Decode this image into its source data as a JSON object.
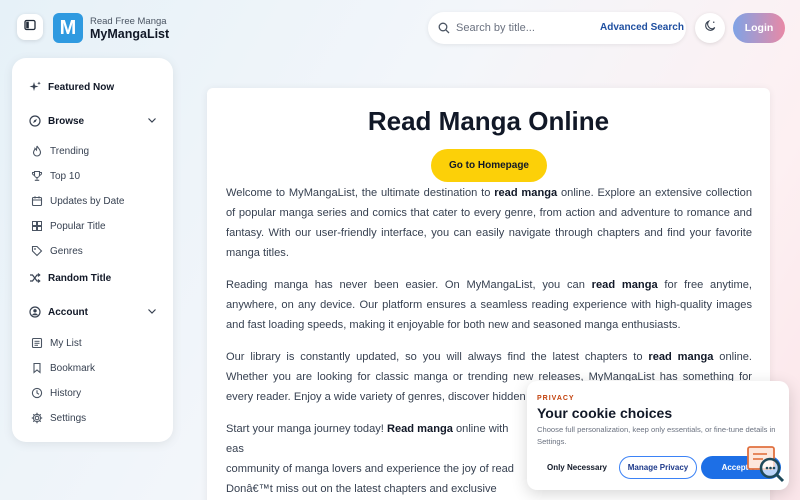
{
  "header": {
    "brand_sub": "Read Free Manga",
    "brand_name": "MyMangaList",
    "logo_letter": "M",
    "search_placeholder": "Search by title...",
    "advanced_search": "Advanced Search",
    "login": "Login"
  },
  "sidebar": {
    "featured": "Featured Now",
    "browse": "Browse",
    "browse_items": [
      "Trending",
      "Top 10",
      "Updates by Date",
      "Popular Title",
      "Genres"
    ],
    "random": "Random Title",
    "account": "Account",
    "account_items": [
      "My List",
      "Bookmark",
      "History",
      "Settings"
    ]
  },
  "main": {
    "title": "Read Manga Online",
    "home_button": "Go to Homepage",
    "p1": [
      "Welcome to MyMangaList, the ultimate destination to ",
      "read manga",
      " online. Explore an extensive collection of popular manga series and comics that cater to every genre, from action and adventure to romance and fantasy. With our user-friendly interface, you can easily navigate through chapters and find your favorite manga titles."
    ],
    "p2": [
      "Reading manga has never been easier. On MyMangaList, you can ",
      "read manga",
      " for free anytime, anywhere, on any device. Our platform ensures a seamless reading experience with high-quality images and fast loading speeds, making it enjoyable for both new and seasoned manga enthusiasts."
    ],
    "p3": [
      "Our library is constantly updated, so you will always find the latest chapters to ",
      "read manga",
      " online. Whether you are looking for classic manga or trending new releases, MyMangaList has something for every reader. Enjoy a wide variety of genres, discover hidden gems, and imm"
    ],
    "p4": [
      "Start your manga journey today! ",
      "Read manga",
      " online with eas",
      "community of manga lovers and experience the joy of read",
      "Donâ€™t miss out on the latest chapters and exclusive release"
    ]
  },
  "cookie": {
    "kicker": "PRIVACY",
    "title": "Your cookie choices",
    "desc": "Choose full personalization, keep only essentials, or fine-tune details in Settings.",
    "only_necessary": "Only Necessary",
    "manage": "Manage Privacy",
    "accept": "Accept All"
  },
  "colors": {
    "brand": "#2f9ae0",
    "accent_yellow": "#fcd008",
    "accept_blue": "#1d6fe6"
  }
}
